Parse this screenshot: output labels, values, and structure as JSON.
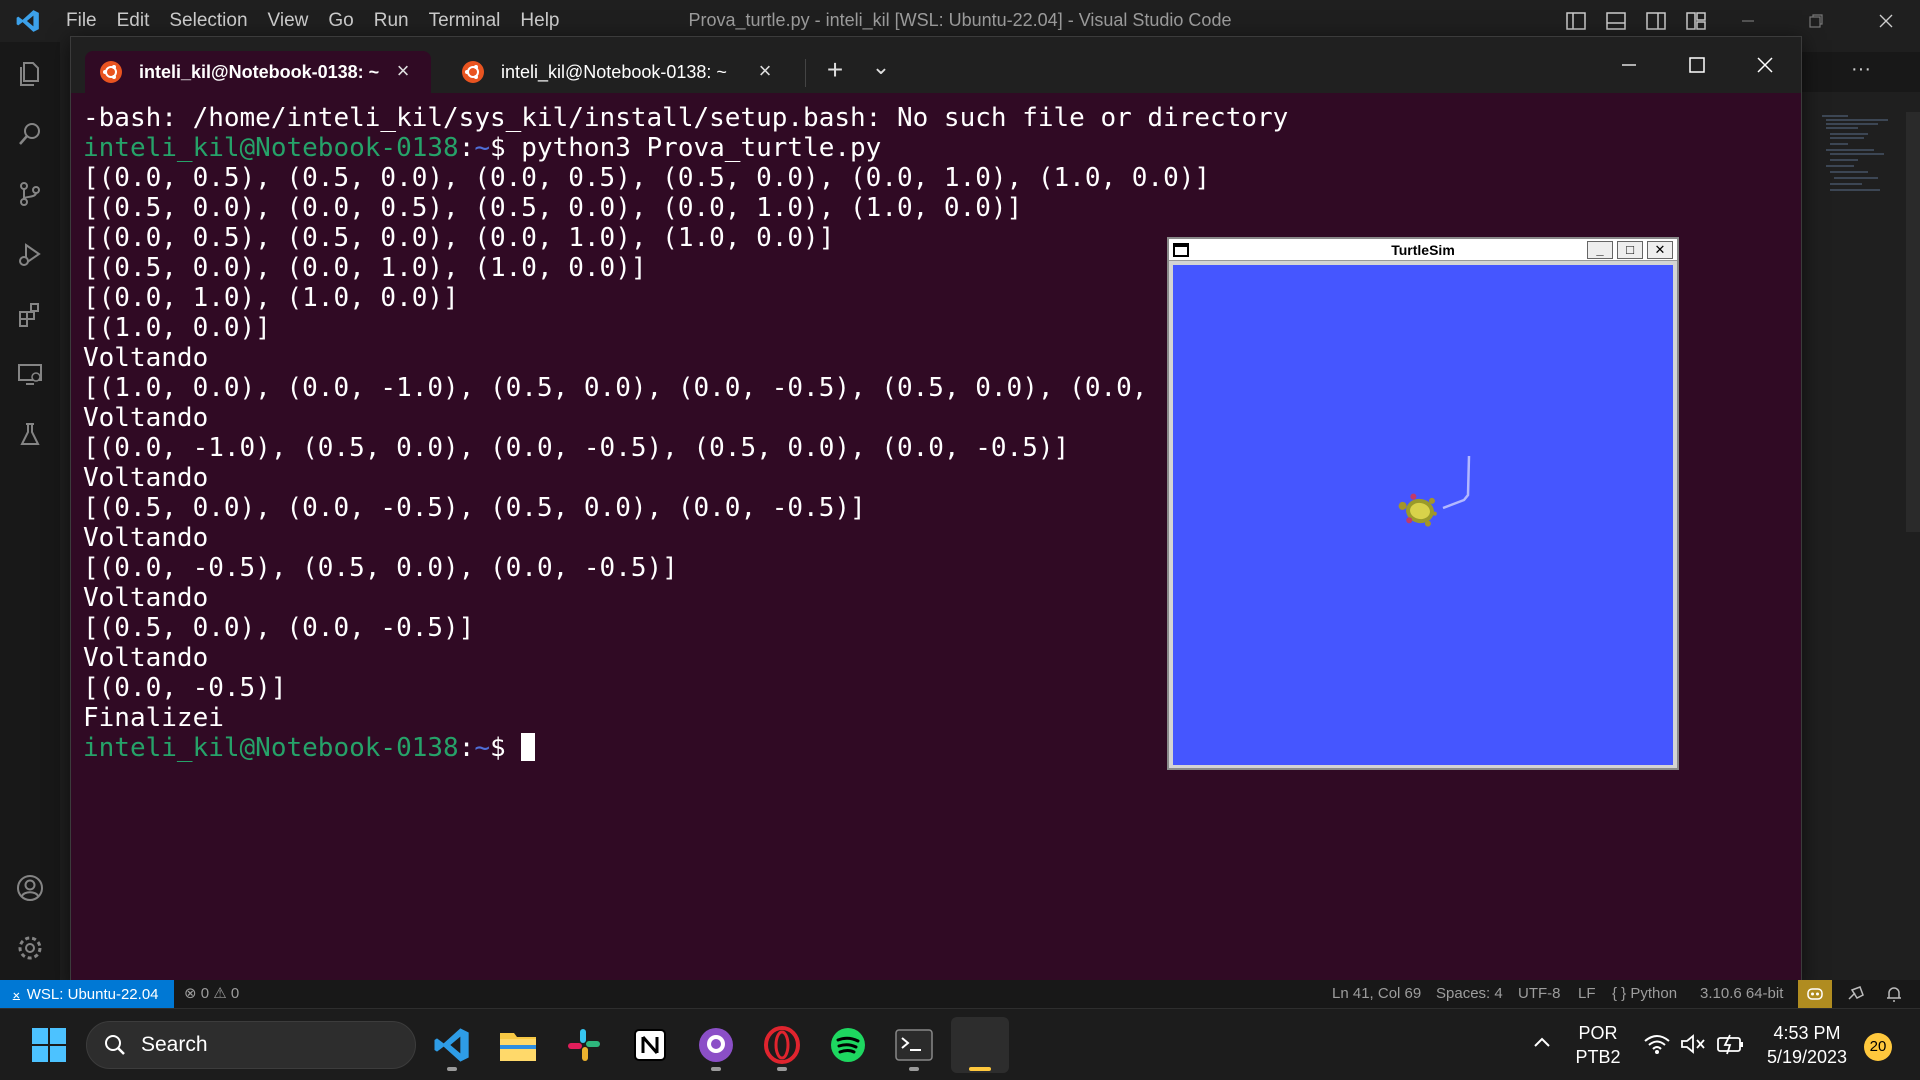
{
  "vscode": {
    "title": "Prova_turtle.py - inteli_kil [WSL: Ubuntu-22.04] - Visual Studio Code",
    "menu": [
      "File",
      "Edit",
      "Selection",
      "View",
      "Go",
      "Run",
      "Terminal",
      "Help"
    ],
    "editor_tab_more": "···"
  },
  "terminal": {
    "tabs": [
      {
        "label": "inteli_kil@Notebook-0138: ~",
        "active": true
      },
      {
        "label": "inteli_kil@Notebook-0138: ~",
        "active": false
      }
    ],
    "new_tab": "+",
    "dropdown": "⌄",
    "lines": [
      {
        "type": "text",
        "text": "-bash: /home/inteli_kil/sys_kil/install/setup.bash: No such file or directory"
      },
      {
        "type": "prompt",
        "user": "inteli_kil@Notebook-0138",
        "sep": ":",
        "path": "~",
        "cmd": "$ python3 Prova_turtle.py"
      },
      {
        "type": "text",
        "text": "[(0.0, 0.5), (0.5, 0.0), (0.0, 0.5), (0.5, 0.0), (0.0, 1.0), (1.0, 0.0)]"
      },
      {
        "type": "text",
        "text": "[(0.5, 0.0), (0.0, 0.5), (0.5, 0.0), (0.0, 1.0), (1.0, 0.0)]"
      },
      {
        "type": "text",
        "text": "[(0.0, 0.5), (0.5, 0.0), (0.0, 1.0), (1.0, 0.0)]"
      },
      {
        "type": "text",
        "text": "[(0.5, 0.0), (0.0, 1.0), (1.0, 0.0)]"
      },
      {
        "type": "text",
        "text": "[(0.0, 1.0), (1.0, 0.0)]"
      },
      {
        "type": "text",
        "text": "[(1.0, 0.0)]"
      },
      {
        "type": "text",
        "text": "Voltando"
      },
      {
        "type": "text",
        "text": "[(1.0, 0.0), (0.0, -1.0), (0.5, 0.0), (0.0, -0.5), (0.5, 0.0), (0.0, -0."
      },
      {
        "type": "text",
        "text": "Voltando"
      },
      {
        "type": "text",
        "text": "[(0.0, -1.0), (0.5, 0.0), (0.0, -0.5), (0.5, 0.0), (0.0, -0.5)]"
      },
      {
        "type": "text",
        "text": "Voltando"
      },
      {
        "type": "text",
        "text": "[(0.5, 0.0), (0.0, -0.5), (0.5, 0.0), (0.0, -0.5)]"
      },
      {
        "type": "text",
        "text": "Voltando"
      },
      {
        "type": "text",
        "text": "[(0.0, -0.5), (0.5, 0.0), (0.0, -0.5)]"
      },
      {
        "type": "text",
        "text": "Voltando"
      },
      {
        "type": "text",
        "text": "[(0.5, 0.0), (0.0, -0.5)]"
      },
      {
        "type": "text",
        "text": "Voltando"
      },
      {
        "type": "text",
        "text": "[(0.0, -0.5)]"
      },
      {
        "type": "text",
        "text": "Finalizei"
      },
      {
        "type": "prompt",
        "user": "inteli_kil@Notebook-0138",
        "sep": ":",
        "path": "~",
        "cmd": "$ ",
        "cursor": true
      }
    ]
  },
  "turtlesim": {
    "title": "TurtleSim",
    "buttons": [
      "_",
      "□",
      "✕"
    ],
    "background_color": "#4556ff",
    "pen_color": "#b3b8ff"
  },
  "status_bar": {
    "remote": "WSL: Ubuntu-22.04",
    "problems": "⊗ 0 ⚠ 0",
    "position": "Ln 41, Col 69",
    "spaces": "Spaces: 4",
    "encoding": "UTF-8",
    "eol": "LF",
    "language": "{ } Python",
    "interpreter": "3.10.6 64-bit"
  },
  "taskbar": {
    "search_placeholder": "Search",
    "language_top": "POR",
    "language_bottom": "PTB2",
    "time": "4:53 PM",
    "date": "5/19/2023",
    "notifications": "20"
  }
}
